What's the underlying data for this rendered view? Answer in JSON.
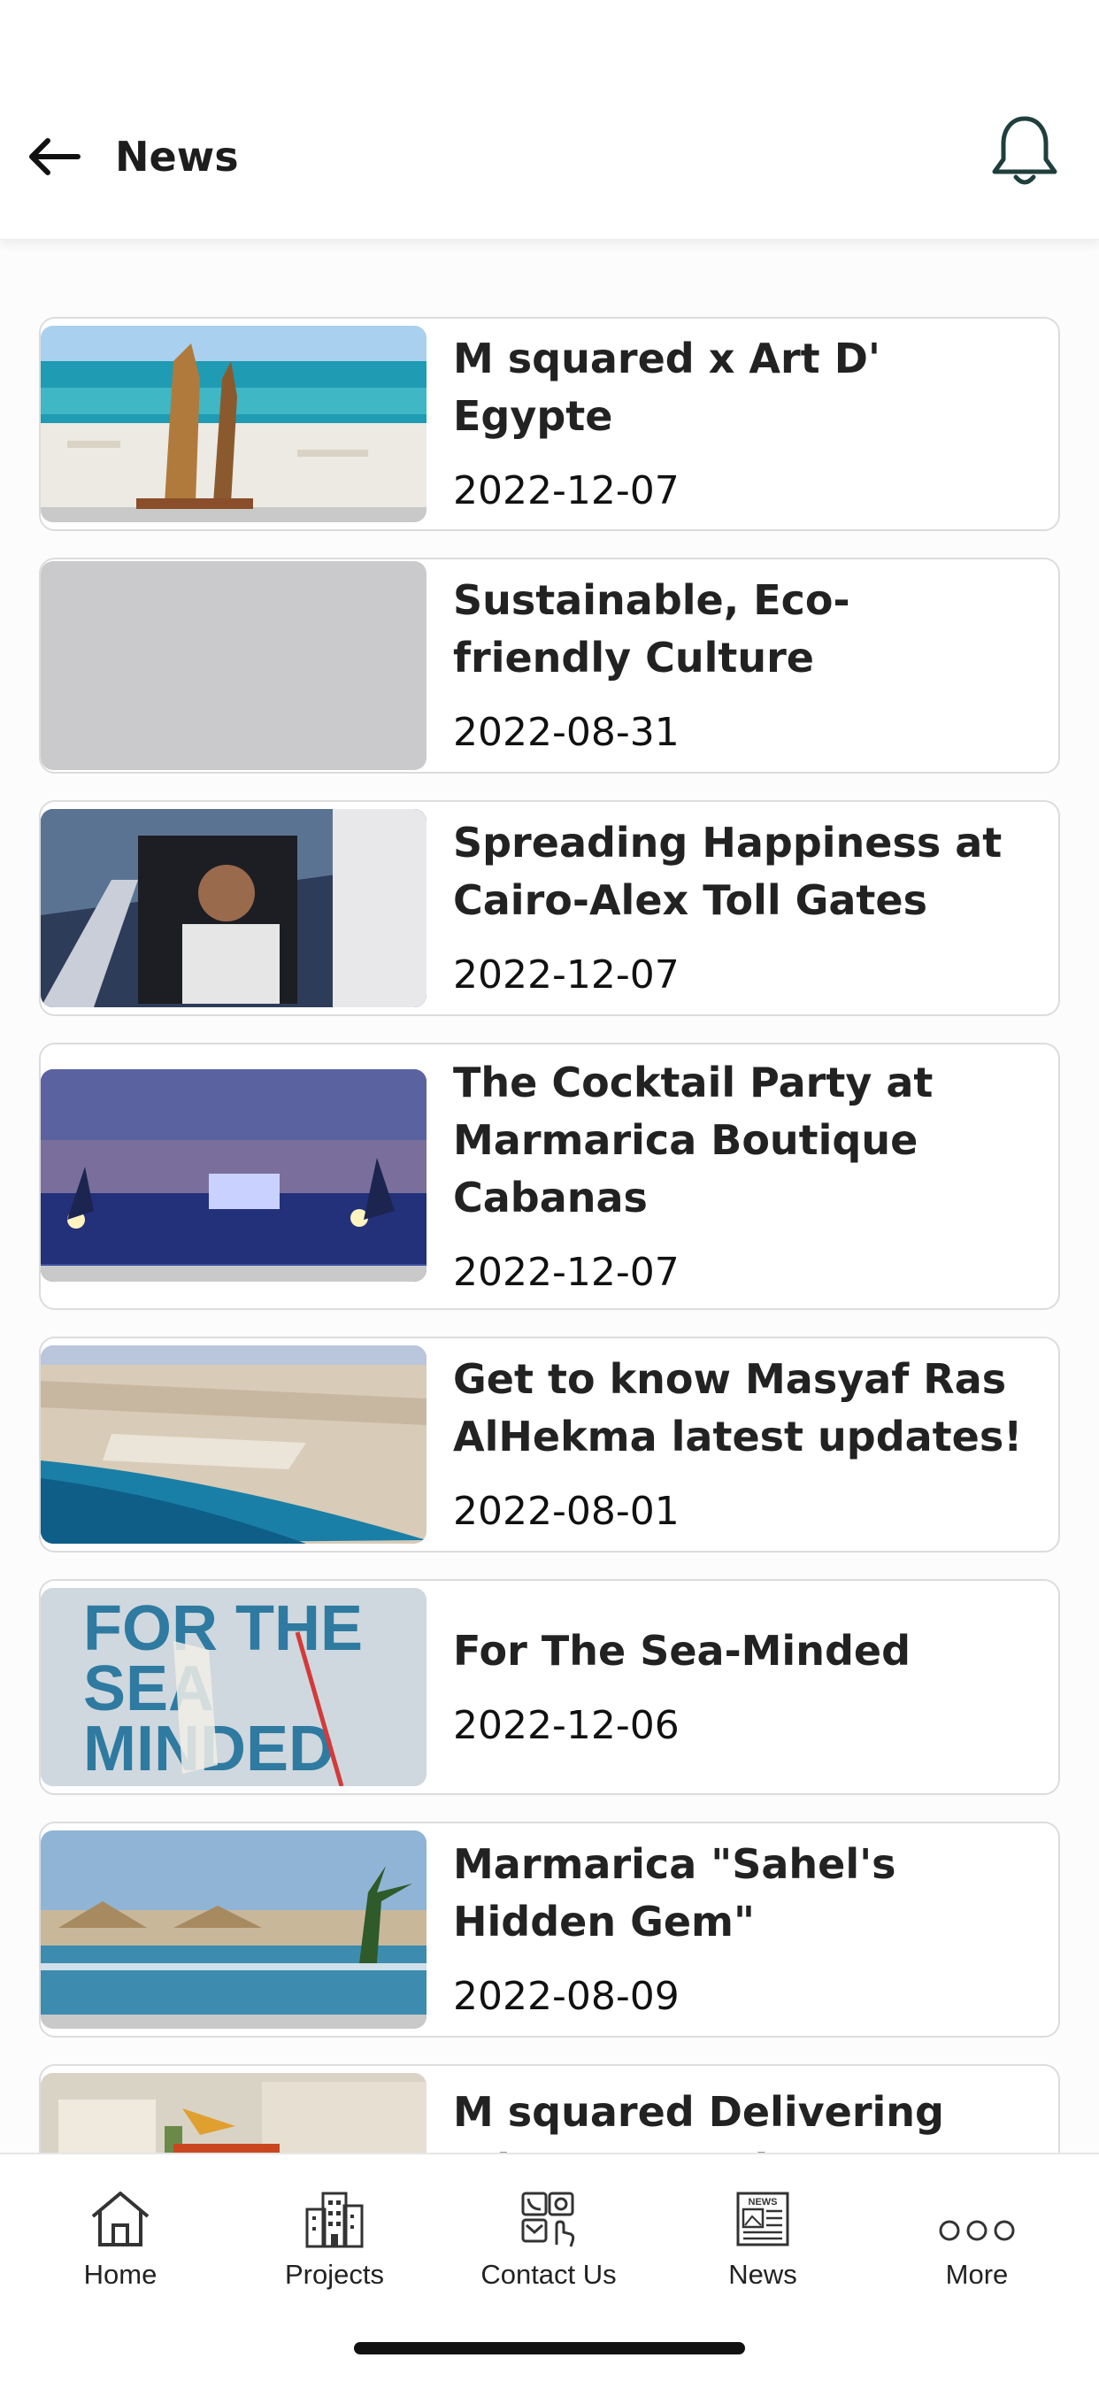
{
  "header": {
    "title": "News"
  },
  "news": [
    {
      "title": "M squared x Art D' Egypte",
      "date": "2022-12-07",
      "image": "beach-sculpture"
    },
    {
      "title": "Sustainable, Eco-friendly Culture",
      "date": "2022-08-31",
      "image": "placeholder"
    },
    {
      "title": "Spreading Happiness at Cairo-Alex Toll Gates",
      "date": "2022-12-07",
      "image": "car-driver"
    },
    {
      "title": "The Cocktail Party at Marmarica Boutique Cabanas",
      "date": "2022-12-07",
      "image": "evening-pool"
    },
    {
      "title": "Get to know Masyaf Ras AlHekma latest updates!",
      "date": "2022-08-01",
      "image": "aerial-coast"
    },
    {
      "title": "For The Sea-Minded",
      "date": "2022-12-06",
      "image": "for-the-sea-minded",
      "image_text": "FOR THE SEA MINDED"
    },
    {
      "title": " Marmarica \"Sahel's Hidden Gem\"",
      "date": "2022-08-09",
      "image": "resort-pool"
    },
    {
      "title": "M squared Delivering Trio - New Cairo",
      "date": "",
      "image": "residential-buildings"
    }
  ],
  "tabbar": {
    "items": [
      {
        "label": "Home",
        "icon": "home-icon"
      },
      {
        "label": "Projects",
        "icon": "buildings-icon"
      },
      {
        "label": "Contact Us",
        "icon": "contact-icon"
      },
      {
        "label": "News",
        "icon": "newspaper-icon"
      },
      {
        "label": "More",
        "icon": "more-dots-icon"
      }
    ],
    "news_icon_text": "NEWS"
  },
  "colors": {
    "accent_dark": "#1f3f3d",
    "card_border": "#dcdcdc",
    "placeholder": "#cacacc"
  }
}
